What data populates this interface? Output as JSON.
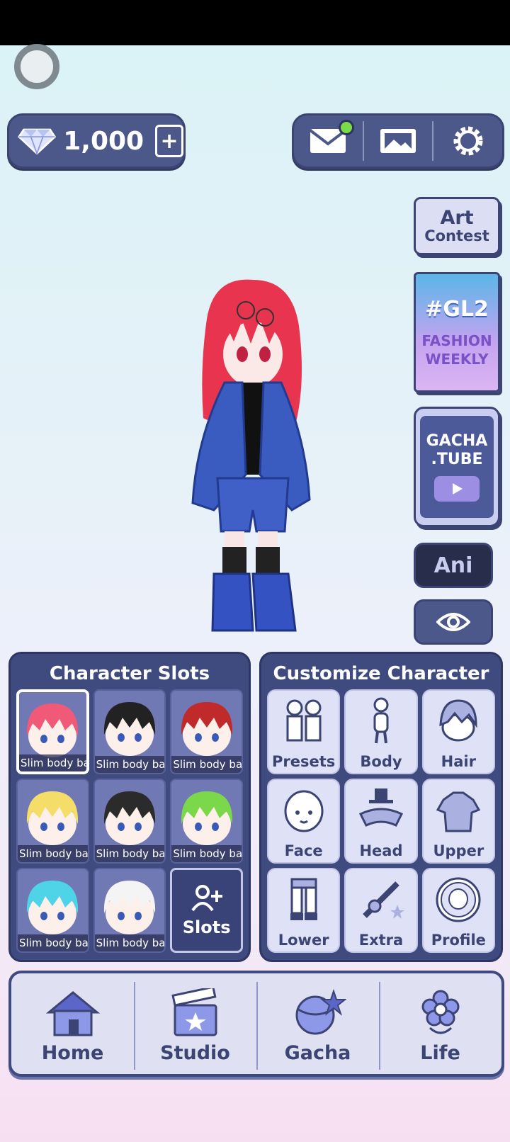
{
  "header": {
    "currency_amount": "1,000",
    "icons": [
      "diamond-icon",
      "video-add-icon",
      "mail-icon",
      "gallery-icon",
      "gear-icon"
    ]
  },
  "side_buttons": {
    "art_contest": {
      "line1": "Art",
      "line2": "Contest"
    },
    "gl2": {
      "tag": "#GL2",
      "line1": "FASHION",
      "line2": "WEEKLY"
    },
    "gacha_tube": {
      "line1": "GACHA",
      "line2": ".TUBE"
    },
    "ani_label": "Ani"
  },
  "character_slots": {
    "title": "Character Slots",
    "slots": [
      {
        "label": "Slim body bas",
        "hair": "#f05a78"
      },
      {
        "label": "Slim body bas",
        "hair": "#222222"
      },
      {
        "label": "Slim body bas",
        "hair": "#c02a2a"
      },
      {
        "label": "Slim body bas",
        "hair": "#f5dd6a"
      },
      {
        "label": "Slim body bas",
        "hair": "#2b2b2b"
      },
      {
        "label": "Slim body bas",
        "hair": "#7ad84a"
      },
      {
        "label": "Slim body bas",
        "hair": "#4fd3e6"
      },
      {
        "label": "Slim body bas",
        "hair": "#f4f4f4"
      }
    ],
    "add_label": "Slots"
  },
  "customize": {
    "title": "Customize Character",
    "items": [
      "Presets",
      "Body",
      "Hair",
      "Face",
      "Head",
      "Upper",
      "Lower",
      "Extra",
      "Profile"
    ]
  },
  "nav": {
    "items": [
      "Home",
      "Studio",
      "Gacha",
      "Life"
    ]
  },
  "colors": {
    "panel": "#3f4a7e",
    "accent": "#4c5889",
    "notification": "#7bdc4a"
  }
}
